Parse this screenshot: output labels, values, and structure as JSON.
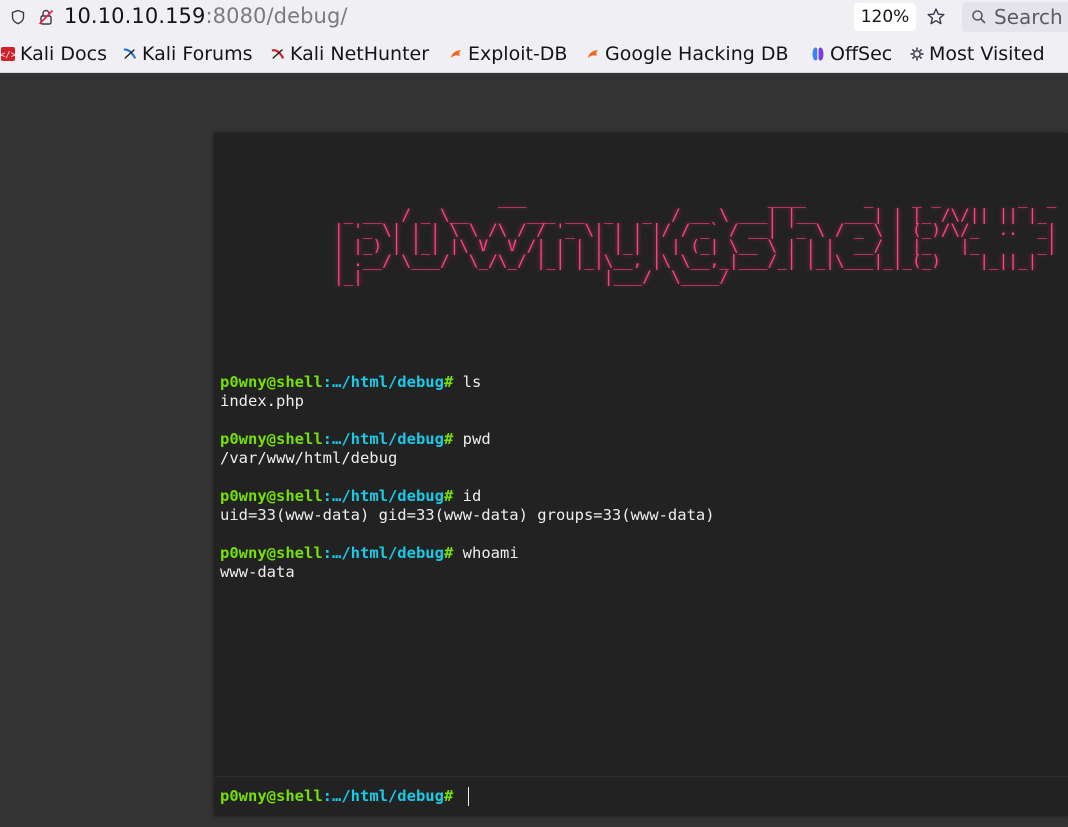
{
  "browser": {
    "url_host": "10.10.10.159",
    "url_rest": ":8080/debug/",
    "zoom": "120%",
    "search_label": "Search"
  },
  "bookmarks": [
    {
      "label": "Kali Docs",
      "icon": "kali-docs-icon"
    },
    {
      "label": "Kali Forums",
      "icon": "kali-forums-icon"
    },
    {
      "label": "Kali NetHunter",
      "icon": "kali-nethunter-icon"
    },
    {
      "label": "Exploit-DB",
      "icon": "exploit-db-icon"
    },
    {
      "label": "Google Hacking DB",
      "icon": "ghdb-icon"
    },
    {
      "label": "OffSec",
      "icon": "offsec-icon"
    },
    {
      "label": "Most Visited",
      "icon": "gear-icon"
    }
  ],
  "shell": {
    "banner": "                 ___                         ____      _    _ _        _  _\n _ __  / _ \\__      ___ __  _   _  / __ \\ ___| |__   ___| | |_ /\\/|| || |_\n| '_ \\| | | \\ \\ /\\ / / '_ \\| | | |/ / _` / __| '_ \\ / _ \\ | (_)/\\/_  ..  _|\n| |_) | |_| |\\ V  V /| | | | |_| | | (_| \\__ \\ | | |  __/ | |_   |_      _|\n| .__/ \\___/  \\_/\\_/ |_| |_|\\__, |\\ \\__,_|___/_| |_|\\___|_|_(_)    |_||_|\n|_|                         |___/  \\____/",
    "prompt": {
      "user": "p0wny@shell",
      "path": ":…/html/debug",
      "hash": "#"
    },
    "history": [
      {
        "command": "ls",
        "output": "index.php"
      },
      {
        "command": "pwd",
        "output": "/var/www/html/debug"
      },
      {
        "command": "id",
        "output": "uid=33(www-data) gid=33(www-data) groups=33(www-data)"
      },
      {
        "command": "whoami",
        "output": "www-data"
      }
    ],
    "input_value": ""
  },
  "colors": {
    "banner": "#ff4180",
    "prompt_user": "#75df0b",
    "prompt_path": "#1bc9e7",
    "terminal_bg": "#222222",
    "page_bg": "#333333"
  }
}
